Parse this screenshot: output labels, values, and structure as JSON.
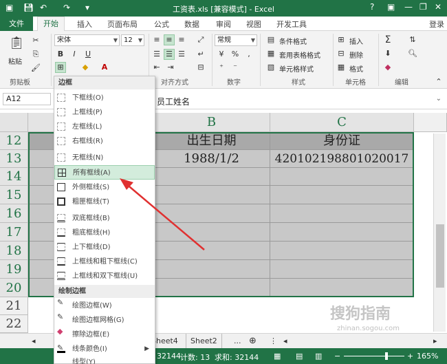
{
  "window": {
    "title": "工资表.xls [兼容模式] - Excel",
    "help": "?",
    "login": "登录"
  },
  "tabs": [
    "文件",
    "开始",
    "插入",
    "页面布局",
    "公式",
    "数据",
    "审阅",
    "视图",
    "开发工具"
  ],
  "ribbon": {
    "paste_label": "粘贴",
    "clipboard_label": "剪贴板",
    "font_name": "宋体",
    "font_size": "12",
    "bold": "B",
    "italic": "I",
    "underline": "U",
    "font_color_glyph": "A",
    "number_format": "常规",
    "alignment_label": "对齐方式",
    "number_label": "数字",
    "conditional_format": "条件格式",
    "table_format": "套用表格格式",
    "cell_style": "单元格样式",
    "style_label": "样式",
    "insert": "插入",
    "delete": "删除",
    "format": "格式",
    "cells_label": "单元格",
    "edit_label": "编辑",
    "sigma": "Σ"
  },
  "formula_bar": {
    "name_box": "A12",
    "content": "员工姓名"
  },
  "grid": {
    "columns": [
      "B",
      "C"
    ],
    "rows": [
      "12",
      "13",
      "14",
      "15",
      "16",
      "17",
      "18",
      "19",
      "20",
      "21",
      "22"
    ],
    "header_row": {
      "a": "员",
      "b": "出生日期",
      "c": "身份证"
    },
    "data_row": {
      "b": "1988/1/2",
      "c": "420102198801020017"
    }
  },
  "menu": {
    "section_border": "边框",
    "items": [
      "下框线(O)",
      "上框线(P)",
      "左框线(L)",
      "右框线(R)",
      "无框线(N)",
      "所有框线(A)",
      "外侧框线(S)",
      "粗匣框线(T)",
      "双底框线(B)",
      "粗底框线(H)",
      "上下框线(D)",
      "上框线和粗下框线(C)",
      "上框线和双下框线(U)"
    ],
    "section_draw": "绘制边框",
    "draw_items": [
      "绘图边框(W)",
      "绘图边框网格(G)",
      "擦除边框(E)",
      "线条颜色(I)",
      "线型(Y)"
    ],
    "highlighted": "所有框线(A)"
  },
  "sheet_tabs": [
    "Sheet4",
    "Sheet2"
  ],
  "sheet_more": "...",
  "status": {
    "avg_value": "32144",
    "count": "计数: 13",
    "sum": "求和: 32144",
    "zoom": "165%"
  },
  "watermark": "搜狗指南",
  "watermark_url": "zhinan.sogou.com",
  "colors": {
    "accent": "#217346",
    "arrow": "#e03030"
  }
}
